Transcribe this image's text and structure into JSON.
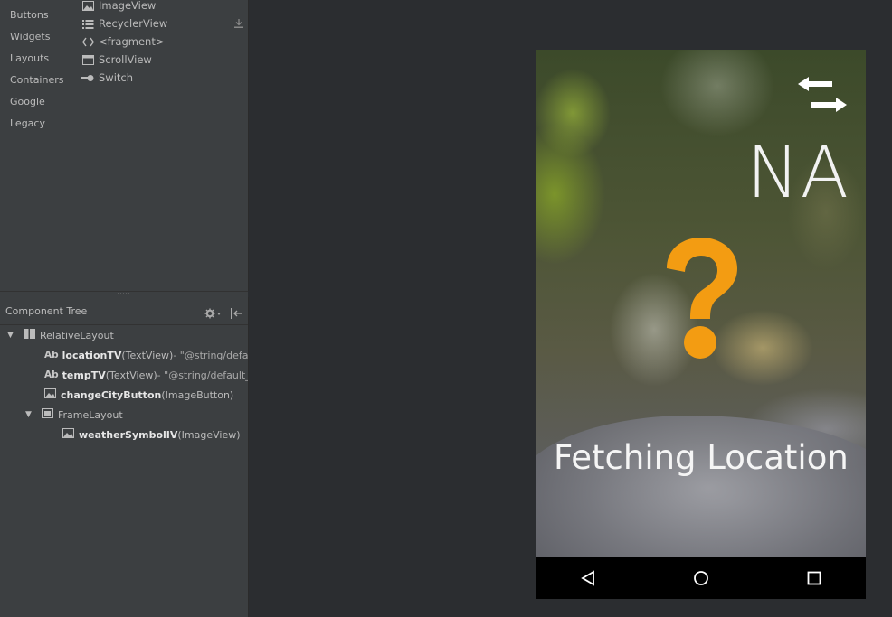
{
  "palette": {
    "categories": [
      "Buttons",
      "Widgets",
      "Layouts",
      "Containers",
      "Google",
      "Legacy"
    ],
    "items": [
      {
        "label": "ImageView",
        "icon": "image-icon"
      },
      {
        "label": "RecyclerView",
        "icon": "list-icon"
      },
      {
        "label": "<fragment>",
        "icon": "code-brackets-icon"
      },
      {
        "label": "ScrollView",
        "icon": "scrollview-icon"
      },
      {
        "label": "Switch",
        "icon": "switch-toggle-icon"
      }
    ]
  },
  "component_tree": {
    "title": "Component Tree",
    "nodes": [
      {
        "name": "RelativeLayout",
        "type": "",
        "detail": ""
      },
      {
        "name": "locationTV",
        "type": " (TextView)",
        "detail": " - \"@string/default_location\""
      },
      {
        "name": "tempTV",
        "type": " (TextView)",
        "detail": " - \"@string/default_temp\""
      },
      {
        "name": "changeCityButton",
        "type": " (ImageButton)",
        "detail": ""
      },
      {
        "name": "FrameLayout",
        "type": "",
        "detail": ""
      },
      {
        "name": "weatherSymbolIV",
        "type": " (ImageView)",
        "detail": ""
      }
    ],
    "textview_prefix": "Ab"
  },
  "device": {
    "temperature": "NA",
    "location": "Fetching Location",
    "accent_color": "#f39c12"
  }
}
